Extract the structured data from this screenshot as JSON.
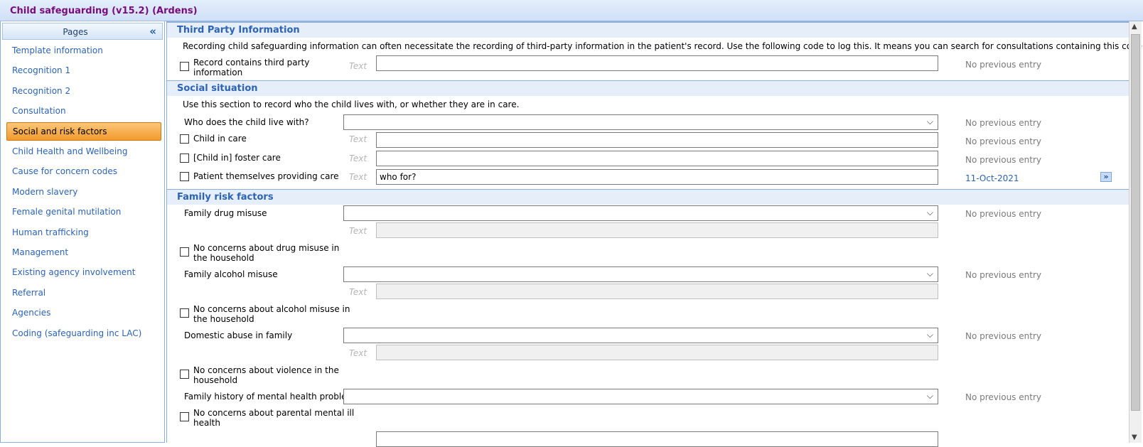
{
  "window": {
    "title": "Child safeguarding (v15.2) (Ardens)"
  },
  "sidebar": {
    "header": "Pages",
    "collapse_icon": "«",
    "items": [
      {
        "label": "Template information",
        "active": false
      },
      {
        "label": "Recognition 1",
        "active": false
      },
      {
        "label": "Recognition 2",
        "active": false
      },
      {
        "label": "Consultation",
        "active": false
      },
      {
        "label": "Social and risk factors",
        "active": true
      },
      {
        "label": "Child Health and Wellbeing",
        "active": false
      },
      {
        "label": "Cause for concern codes",
        "active": false
      },
      {
        "label": "Modern slavery",
        "active": false
      },
      {
        "label": "Female genital mutilation",
        "active": false
      },
      {
        "label": "Human trafficking",
        "active": false
      },
      {
        "label": "Management",
        "active": false
      },
      {
        "label": "Existing agency involvement",
        "active": false
      },
      {
        "label": "Referral",
        "active": false
      },
      {
        "label": "Agencies",
        "active": false
      },
      {
        "label": "Coding (safeguarding inc LAC)",
        "active": false
      }
    ]
  },
  "common": {
    "text_hint": "Text",
    "no_previous": "No previous entry",
    "dropdown_arrow": "⌵"
  },
  "third_party": {
    "header": "Third Party Information",
    "description": "Recording child safeguarding information can often necessitate the recording of third-party information in the patient's record. Use the following code to log this. It means you can search for consultations containing this code if needed:",
    "record_label_1": "Record contains third party",
    "record_label_2": "information",
    "record_value": ""
  },
  "social": {
    "header": "Social situation",
    "description": "Use this section to record who the child lives with, or whether they are in care.",
    "lives_with_label": "Who does the child live with?",
    "lives_with_value": "",
    "child_in_care_label": "Child in care",
    "foster_care_label": "[Child in] foster care",
    "providing_care_label": "Patient themselves providing care",
    "providing_care_value": "who for?",
    "providing_care_prev": "11-Oct-2021",
    "more_icon": "»"
  },
  "family": {
    "header": "Family risk factors",
    "drug_label": "Family drug misuse",
    "no_drug_1": "No concerns about drug misuse in",
    "no_drug_2": "the household",
    "alcohol_label": "Family alcohol misuse",
    "no_alcohol_1": "No concerns about alcohol misuse in",
    "no_alcohol_2": "the household",
    "domestic_label": "Domestic abuse in family",
    "no_violence_1": "No concerns about violence in the",
    "no_violence_2": "household",
    "mental_label": "Family history of mental health problems?",
    "no_mental_1": "No concerns about parental mental ill",
    "no_mental_2": "health"
  }
}
